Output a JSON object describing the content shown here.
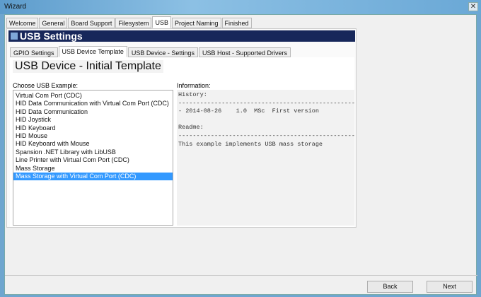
{
  "window": {
    "title": "Wizard",
    "close": "✕"
  },
  "tabs": [
    "Welcome",
    "General",
    "Board Support",
    "Filesystem",
    "USB",
    "Project Naming",
    "Finished"
  ],
  "banner": "USB Settings",
  "subtabs": [
    "GPIO Settings",
    "USB Device Template",
    "USB Device - Settings",
    "USB Host - Supported Drivers"
  ],
  "heading": "USB Device - Initial Template",
  "list_label": "Choose USB Example:",
  "info_label": "Information:",
  "examples": [
    "Virtual Com Port (CDC)",
    "HID Data Communication with Virtual Com Port (CDC)",
    "HID Data Communication",
    "HID Joystick",
    "HID Keyboard",
    "HID Mouse",
    "HID Keyboard with Mouse",
    "Spansion .NET Library with LibUSB",
    "Line Printer with Virtual Com Port (CDC)",
    "Mass Storage",
    "Mass Storage with Virtual Com Port (CDC)"
  ],
  "selected_example": "Mass Storage with Virtual Com Port (CDC)",
  "info_text": "History:\n-----------------------------------------------------------\n- 2014-08-26    1.0  MSc  First version\n\nReadme:\n-----------------------------------------------------------\nThis example implements USB mass storage",
  "buttons": {
    "back": "Back",
    "next": "Next"
  }
}
